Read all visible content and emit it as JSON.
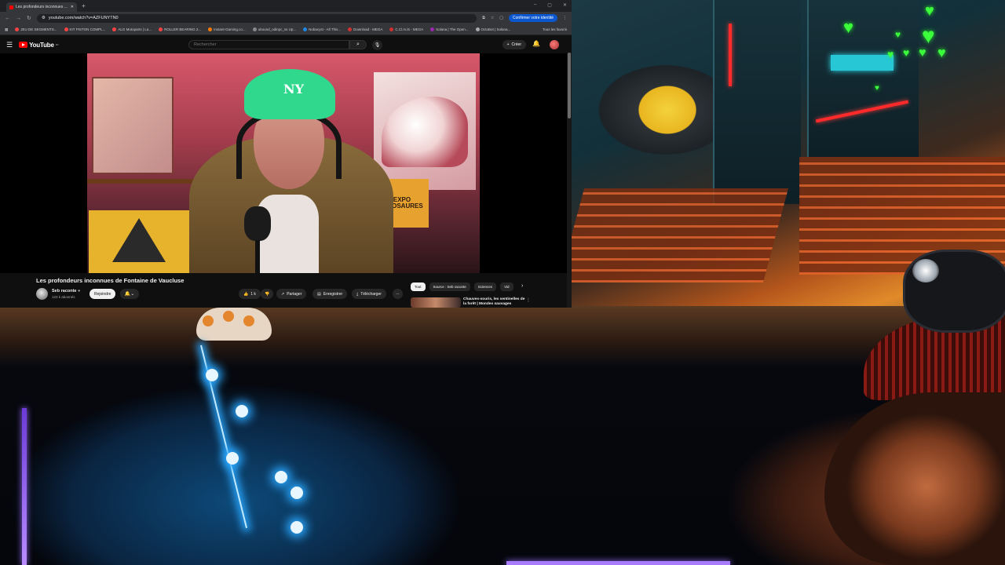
{
  "browser": {
    "tab_title": "Les profondeurs inconnues ...",
    "new_tab": "+",
    "window_controls": [
      "–",
      "▢",
      "✕"
    ],
    "url": "youtube.com/watch?v=AZFUNYTN0",
    "confirm_label": "Confirmer votre identité",
    "bookmarks": [
      {
        "label": "JEU DE SEGMENTS...",
        "color": "#ff4444"
      },
      {
        "label": "KIT PISTON COMPL...",
        "color": "#ff4444"
      },
      {
        "label": "ALG Motoparts | La...",
        "color": "#ff4444"
      },
      {
        "label": "ROLLER BEARING 2...",
        "color": "#ff4444"
      },
      {
        "label": "Instant-Gaming.co...",
        "color": "#ff7a00"
      },
      {
        "label": "ubound_odinpc_ss Up...",
        "color": "#888888"
      },
      {
        "label": "Nobacyst - All This...",
        "color": "#1e88e5"
      },
      {
        "label": "Download - MEGA",
        "color": "#d32f2f"
      },
      {
        "label": "C.Cl.m.i5 - MEGA",
        "color": "#d32f2f"
      },
      {
        "label": "Solana | The Open...",
        "color": "#9c27b0"
      },
      {
        "label": "OctoBot | Solana...",
        "color": "#aaaaaa"
      }
    ],
    "all_bookmarks": "Tous les favoris"
  },
  "youtube": {
    "logo_text": "YouTube",
    "logo_region": "FR",
    "search_placeholder": "Rechercher",
    "create_label": "Créer",
    "video": {
      "title": "Les profondeurs inconnues de Fontaine de Vaucluse",
      "cap_text": "NY",
      "dino_text": "EXPO DINOSAURES",
      "channel": "Seb raconte",
      "subscribers": "123 k abonnés",
      "join_label": "Rejoindre",
      "like_count": "1 k",
      "share_label": "Partager",
      "save_label": "Enregistrer",
      "download_label": "Télécharger",
      "more_label": "⋯"
    },
    "chips": [
      "Tout",
      "Source : Seb raconte",
      "Sciences",
      "Vid"
    ],
    "recommended": {
      "title": "Chauves-souris, les sentinelles de la forêt | Mondes sauvages",
      "more": "⋮"
    },
    "scroll_progress": 0.26
  },
  "overlay": {
    "hearts": [
      "♥",
      "♥",
      "♥",
      "♥",
      "♥",
      "♥",
      "♥",
      "♥",
      "♥"
    ]
  }
}
